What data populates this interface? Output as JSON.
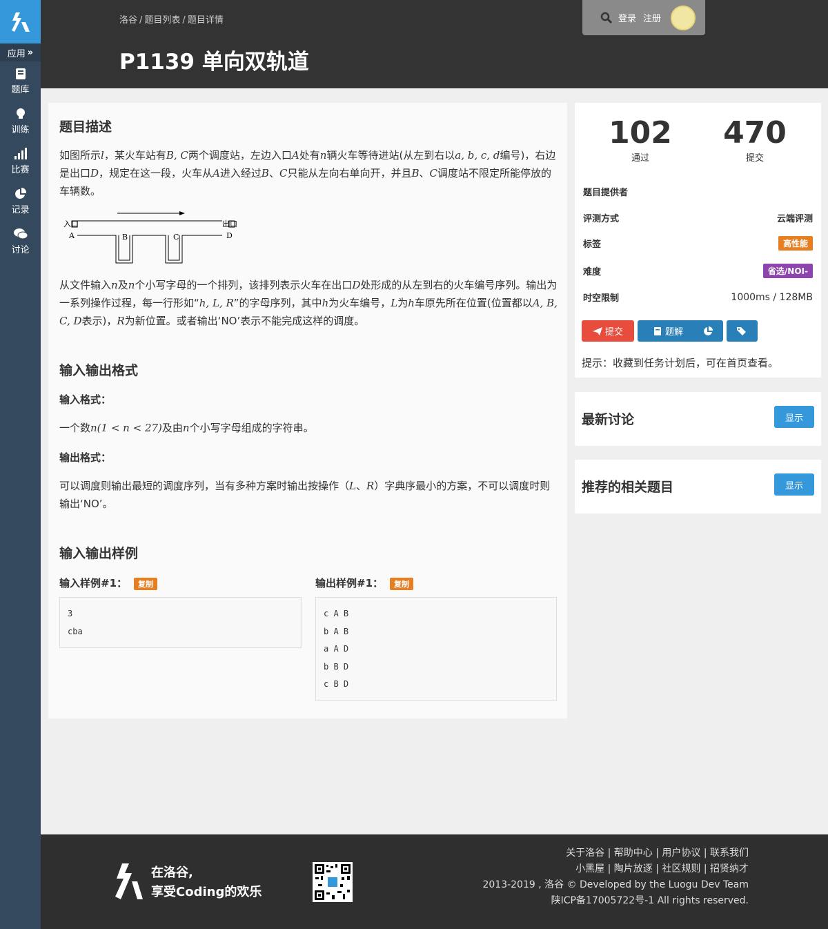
{
  "sidebar": {
    "app_label": "应用",
    "items": [
      {
        "label": "题库",
        "icon": "book-icon"
      },
      {
        "label": "训练",
        "icon": "lightbulb-icon"
      },
      {
        "label": "比赛",
        "icon": "bar-chart-icon"
      },
      {
        "label": "记录",
        "icon": "pie-chart-icon"
      },
      {
        "label": "讨论",
        "icon": "comments-icon"
      }
    ]
  },
  "header": {
    "breadcrumb": [
      "洛谷",
      "题目列表",
      "题目详情"
    ],
    "title": "P1139 单向双轨道",
    "login": "登录",
    "register": "注册"
  },
  "problem": {
    "desc_heading": "题目描述",
    "desc_p1": [
      "如图所示",
      "l",
      "，某火车站有",
      "B, C",
      "两个调度站，左边入口",
      "A",
      "处有",
      "n",
      "辆火车等待进站(从左到右以",
      "a, b, c, d",
      "编号)，右边是出口",
      "D",
      "，规定在这一段，火车从",
      "A",
      "进入经过",
      "B",
      "、",
      "C",
      "只能从左向右单向开，并且",
      "B",
      "、",
      "C",
      "调度站不限定所能停放的车辆数。"
    ],
    "diagram": {
      "entry": "入口",
      "exit": "出口",
      "a": "A",
      "b": "B",
      "c": "C",
      "d": "D"
    },
    "desc_p2": [
      "从文件输入",
      "n",
      "及",
      "n",
      "个小写字母的一个排列，该排列表示火车在出口",
      "D",
      "处形成的从左到右的火车编号序列。输出为一系列操作过程，每一行形如“",
      "h, L, R",
      "”的字母序列，其中",
      "h",
      "为火车编号，",
      "L",
      "为",
      "h",
      "车原先所在位置(位置都以",
      "A, B, C, D",
      "表示)，",
      "R",
      "为新位置。或者输出‘NO’表示不能完成这样的调度。"
    ],
    "io_heading": "输入输出格式",
    "input_label": "输入格式：",
    "input_text": [
      "一个数",
      "n(1 < n < 27)",
      "及由",
      "n",
      "个小写字母组成的字符串。"
    ],
    "output_label": "输出格式：",
    "output_text": [
      "可以调度则输出最短的调度序列，当有多种方案时输出按操作（",
      "L",
      "、",
      "R",
      "）字典序最小的方案，不可以调度时则输出‘NO’。"
    ],
    "sample_heading": "输入输出样例",
    "sample_in_label": "输入样例#1：",
    "sample_out_label": "输出样例#1：",
    "copy": "复制",
    "sample_in": [
      "3",
      "cba"
    ],
    "sample_out": [
      "c A B",
      "b A B",
      "a A D",
      "b B D",
      "c B D"
    ]
  },
  "info": {
    "passed": "102",
    "passed_label": "通过",
    "submitted": "470",
    "submitted_label": "提交",
    "provider_label": "题目提供者",
    "judge_label": "评测方式",
    "judge_value": "云端评测",
    "tags_label": "标签",
    "tag": "高性能",
    "difficulty_label": "难度",
    "difficulty": "省选/NOI-",
    "limit_label": "时空限制",
    "limit_value": "1000ms / 128MB",
    "btn_submit": "提交",
    "btn_solution": "题解",
    "hint": "提示：收藏到任务计划后，可在首页查看。"
  },
  "discuss": {
    "title": "最新讨论",
    "show": "显示"
  },
  "related": {
    "title": "推荐的相关题目",
    "show": "显示"
  },
  "footer": {
    "slogan1": "在洛谷,",
    "slogan2": "享受Coding的欢乐",
    "links1": "关于洛谷 | 帮助中心 | 用户协议 | 联系我们",
    "links2": "小黑屋 | 陶片放逐 | 社区规则 | 招贤纳才",
    "copyright": "2013-2019 , 洛谷 © Developed by the Luogu Dev Team",
    "icp": "陕ICP备17005722号-1 All rights reserved."
  },
  "colors": {
    "sidebar": "#34495e",
    "accent": "#3498db",
    "submit_red": "#e74c3c",
    "tag_orange": "#e67e22",
    "difficulty_purple": "#8e44ad"
  }
}
